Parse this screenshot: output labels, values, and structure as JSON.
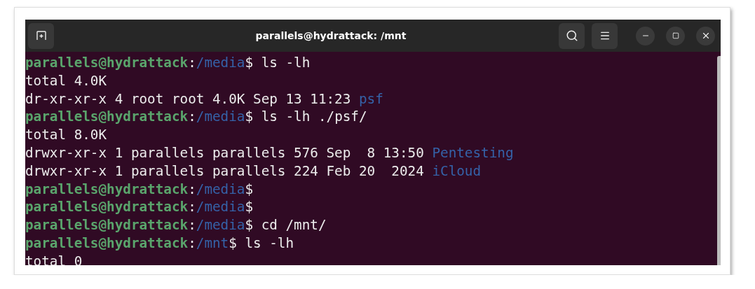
{
  "window": {
    "title": "parallels@hydrattack: /mnt"
  },
  "terminal": {
    "lines": [
      {
        "segments": [
          {
            "kind": "user",
            "text": "parallels@hydrattack"
          },
          {
            "kind": "text",
            "text": ":"
          },
          {
            "kind": "path",
            "text": "/media"
          },
          {
            "kind": "text",
            "text": "$ ls -lh"
          }
        ]
      },
      {
        "segments": [
          {
            "kind": "text",
            "text": "total 4.0K"
          }
        ]
      },
      {
        "segments": [
          {
            "kind": "text",
            "text": "dr-xr-xr-x 4 root root 4.0K Sep 13 11:23 "
          },
          {
            "kind": "dir",
            "text": "psf"
          }
        ]
      },
      {
        "segments": [
          {
            "kind": "user",
            "text": "parallels@hydrattack"
          },
          {
            "kind": "text",
            "text": ":"
          },
          {
            "kind": "path",
            "text": "/media"
          },
          {
            "kind": "text",
            "text": "$ ls -lh ./psf/"
          }
        ]
      },
      {
        "segments": [
          {
            "kind": "text",
            "text": "total 8.0K"
          }
        ]
      },
      {
        "segments": [
          {
            "kind": "text",
            "text": "drwxr-xr-x 1 parallels parallels 576 Sep  8 13:50 "
          },
          {
            "kind": "dir",
            "text": "Pentesting"
          }
        ]
      },
      {
        "segments": [
          {
            "kind": "text",
            "text": "drwxr-xr-x 1 parallels parallels 224 Feb 20  2024 "
          },
          {
            "kind": "dir",
            "text": "iCloud"
          }
        ]
      },
      {
        "segments": [
          {
            "kind": "user",
            "text": "parallels@hydrattack"
          },
          {
            "kind": "text",
            "text": ":"
          },
          {
            "kind": "path",
            "text": "/media"
          },
          {
            "kind": "text",
            "text": "$"
          }
        ]
      },
      {
        "segments": [
          {
            "kind": "user",
            "text": "parallels@hydrattack"
          },
          {
            "kind": "text",
            "text": ":"
          },
          {
            "kind": "path",
            "text": "/media"
          },
          {
            "kind": "text",
            "text": "$"
          }
        ]
      },
      {
        "segments": [
          {
            "kind": "user",
            "text": "parallels@hydrattack"
          },
          {
            "kind": "text",
            "text": ":"
          },
          {
            "kind": "path",
            "text": "/media"
          },
          {
            "kind": "text",
            "text": "$ cd /mnt/"
          }
        ]
      },
      {
        "segments": [
          {
            "kind": "user",
            "text": "parallels@hydrattack"
          },
          {
            "kind": "text",
            "text": ":"
          },
          {
            "kind": "path",
            "text": "/mnt"
          },
          {
            "kind": "text",
            "text": "$ ls -lh"
          }
        ]
      },
      {
        "segments": [
          {
            "kind": "text",
            "text": "total 0"
          }
        ]
      }
    ]
  }
}
